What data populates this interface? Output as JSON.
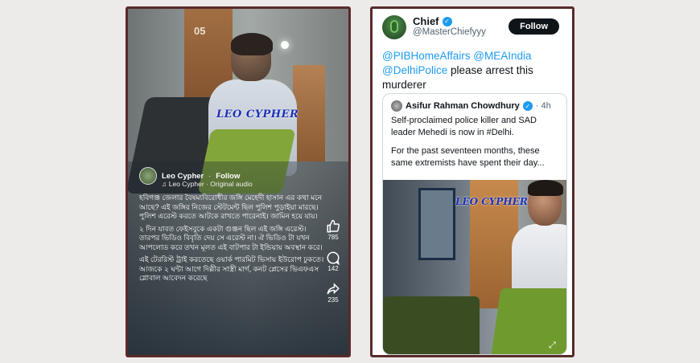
{
  "left": {
    "door_number": "05",
    "watermark": "LEO CYPHER",
    "poster": {
      "name": "Leo Cypher",
      "separator": "·",
      "follow_label": "Follow"
    },
    "audio": "♫ Leo Cypher · Original audio",
    "caption_paragraphs": [
      "হবিগঞ্জ জেলার বৈষম্যবিরোধীর জঙ্গি মেহেদী হাসান এর কথা মনে আছে? এই জঙ্গির নিজের স্টেটমেন্ট ছিল পুলিশ পুড়াইয়া মারছে। পুলিশ এরেস্ট করতে আটকে রাখতে পারেনাই। জামিন হয়ে যায়।",
      "২ দিন যাবত ফেইসবুকে একটা গুঞ্জন ছিল এই জঙ্গি এরেস্ট। তারপর ভিডিও বিবৃতি দেয় সে এরেস্ট না। ঐ ভিডিও টা যখন আপলোড করে তখন মূলত এই বাটপার টা ইন্ডিয়ায় অবস্থান করে।",
      "এই টেররিস্ট ট্রাই করতেছে ওয়ার্ক পারমিট ভিসায় ইউরোপ ঢুকতে। আজকে ২ ঘন্টা আগে দিল্লীর সাস্ত্রী মার্গ, কনট প্লেসের ভিএফএস গ্লোবাল আবেদন করেছে"
    ],
    "rail": [
      {
        "icon": "like-icon",
        "count": "785"
      },
      {
        "icon": "comment-icon",
        "count": "142"
      },
      {
        "icon": "share-icon",
        "count": "235"
      }
    ]
  },
  "right": {
    "author": {
      "name": "Chief",
      "handle": "@MasterChiefyyy",
      "follow_label": "Follow"
    },
    "tweet": {
      "mention1": "@PIBHomeAffairs",
      "mention2": "@MEAIndia",
      "mention3": "@DelhiPolice",
      "text": " please arrest this murderer"
    },
    "quote": {
      "name": "Asifur Rahman Chowdhury",
      "time": "· 4h",
      "para1": "Self-proclaimed police killer and SAD leader Mehedi is now in #Delhi.",
      "para2": "For the past seventeen months, these same extremists have spent their day...",
      "watermark": "LEO CYPHER"
    }
  },
  "colors": {
    "frame_border": "#5a2a2a",
    "mention_blue": "#1d9bf0",
    "verified_blue": "#1d9bf0"
  }
}
